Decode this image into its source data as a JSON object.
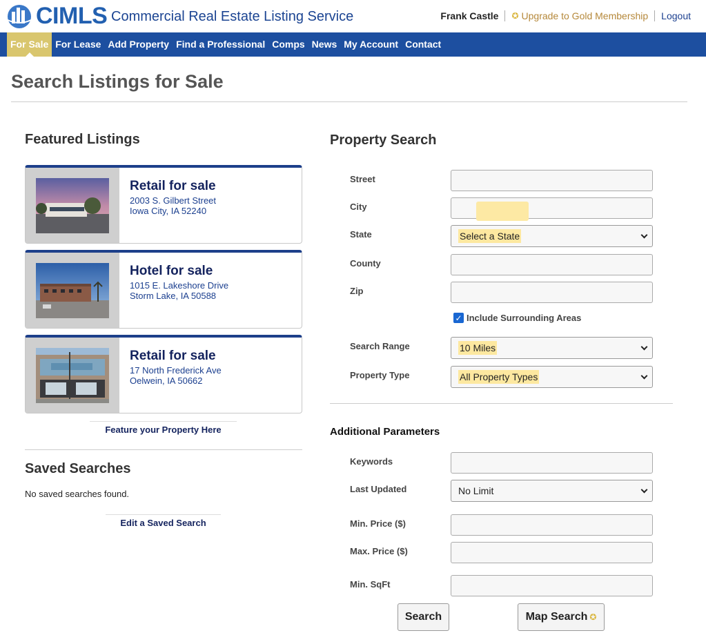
{
  "header": {
    "logo_text": "CIMLS",
    "site_title": "Commercial Real Estate Listing Service",
    "user_name": "Frank Castle",
    "upgrade_label": "Upgrade to Gold Membership",
    "logout_label": "Logout"
  },
  "nav": {
    "items": [
      "For Sale",
      "For Lease",
      "Add Property",
      "Find a Professional",
      "Comps",
      "News",
      "My Account",
      "Contact"
    ],
    "active": "For Sale"
  },
  "page_title": "Search Listings for Sale",
  "featured": {
    "heading": "Featured Listings",
    "listings": [
      {
        "title": "Retail for sale",
        "address": "2003 S. Gilbert Street",
        "city": "Iowa City, IA 52240"
      },
      {
        "title": "Hotel for sale",
        "address": "1015 E. Lakeshore Drive",
        "city": "Storm Lake, IA 50588"
      },
      {
        "title": "Retail for sale",
        "address": "17 North Frederick Ave",
        "city": "Oelwein, IA 50662"
      }
    ],
    "feature_link": "Feature your Property Here"
  },
  "saved": {
    "heading": "Saved Searches",
    "empty_text": "No saved searches found.",
    "edit_link": "Edit a Saved Search"
  },
  "search": {
    "heading": "Property Search",
    "street_label": "Street",
    "city_label": "City",
    "state_label": "State",
    "state_value": "Select a State",
    "county_label": "County",
    "zip_label": "Zip",
    "surrounding_label": "Include Surrounding Areas",
    "surrounding_checked": true,
    "range_label": "Search Range",
    "range_value": "10 Miles",
    "type_label": "Property Type",
    "type_value": "All Property Types"
  },
  "additional": {
    "heading": "Additional Parameters",
    "keywords_label": "Keywords",
    "updated_label": "Last Updated",
    "updated_value": "No Limit",
    "min_price_label": "Min. Price ($)",
    "max_price_label": "Max. Price ($)",
    "min_sqft_label": "Min. SqFt"
  },
  "buttons": {
    "search": "Search",
    "map_search": "Map Search"
  },
  "colors": {
    "nav_bg": "#1d4fa0",
    "active_tab": "#d9c66e",
    "highlight": "#fde9a4",
    "link": "#1b3f8f"
  }
}
